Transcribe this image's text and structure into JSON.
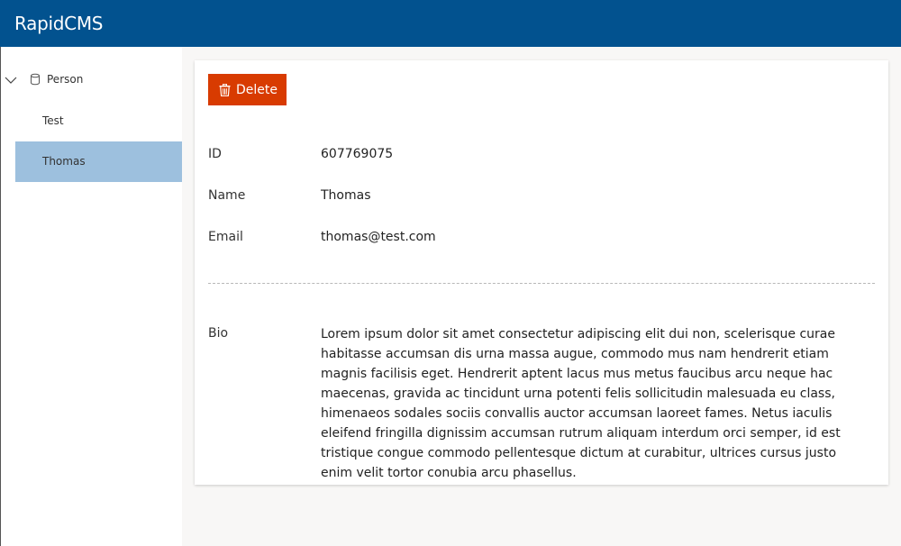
{
  "app": {
    "title": "RapidCMS"
  },
  "sidebar": {
    "root": {
      "label": "Person",
      "icon": "database-icon",
      "expanded": true
    },
    "items": [
      {
        "label": "Test",
        "selected": false
      },
      {
        "label": "Thomas",
        "selected": true
      }
    ]
  },
  "editor": {
    "delete_label": "Delete",
    "fields": {
      "id": {
        "label": "ID",
        "value": "607769075"
      },
      "name": {
        "label": "Name",
        "value": "Thomas"
      },
      "email": {
        "label": "Email",
        "value": "thomas@test.com"
      },
      "bio": {
        "label": "Bio",
        "value": "Lorem ipsum dolor sit amet consectetur adipiscing elit dui non, scelerisque curae habitasse accumsan dis urna massa augue, commodo mus nam hendrerit etiam magnis facilisis eget. Hendrerit aptent lacus mus metus faucibus arcu neque hac maecenas, gravida ac tincidunt urna potenti felis sollicitudin malesuada eu class, himenaeos sodales sociis convallis auctor accumsan laoreet fames. Netus iaculis eleifend fringilla dignissim accumsan rutrum aliquam interdum orci semper, id est tristique congue commodo pellentesque dictum at curabitur, ultrices cursus justo enim velit tortor conubia arcu phasellus."
      }
    }
  },
  "colors": {
    "topbar": "#02528f",
    "selected_item": "#9dc0de",
    "delete_button": "#d83b01"
  }
}
